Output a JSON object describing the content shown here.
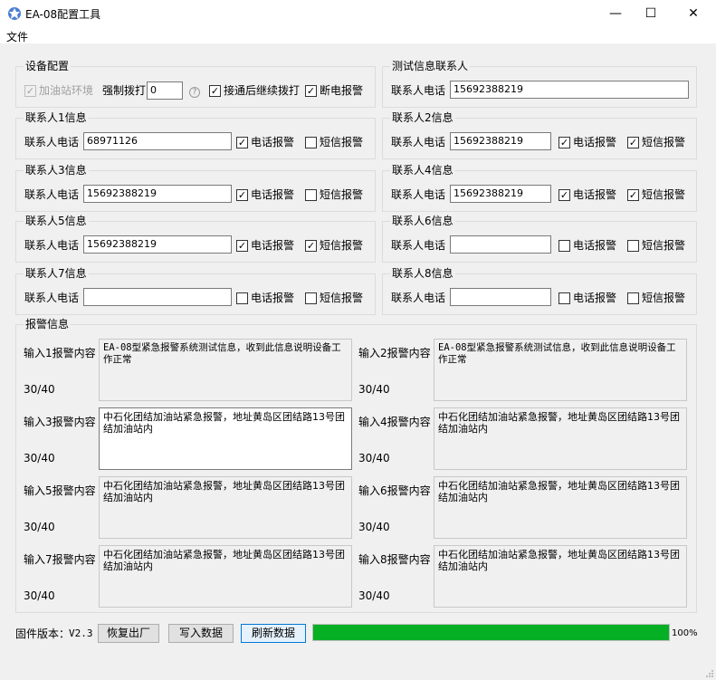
{
  "window": {
    "title": "EA-08配置工具",
    "minimize": "—",
    "maximize": "☐",
    "close": "✕"
  },
  "menu": {
    "file": "文件"
  },
  "device": {
    "group_title": "设备配置",
    "gas_station_env": "加油站环境",
    "gas_station_env_checked": true,
    "force_dial_label": "强制拨打",
    "force_dial_value": "0",
    "help": "?",
    "continue_after_connect": "接通后继续拨打",
    "continue_after_connect_checked": true,
    "power_off_alarm": "断电报警",
    "power_off_alarm_checked": true
  },
  "test_contact": {
    "group_title": "测试信息联系人",
    "phone_label": "联系人电话",
    "phone": "15692388219"
  },
  "contacts": [
    {
      "title": "联系人1信息",
      "phone_label": "联系人电话",
      "phone": "68971126",
      "call_label": "电话报警",
      "call": true,
      "sms_label": "短信报警",
      "sms": false
    },
    {
      "title": "联系人2信息",
      "phone_label": "联系人电话",
      "phone": "15692388219",
      "call_label": "电话报警",
      "call": true,
      "sms_label": "短信报警",
      "sms": true
    },
    {
      "title": "联系人3信息",
      "phone_label": "联系人电话",
      "phone": "15692388219",
      "call_label": "电话报警",
      "call": true,
      "sms_label": "短信报警",
      "sms": false
    },
    {
      "title": "联系人4信息",
      "phone_label": "联系人电话",
      "phone": "15692388219",
      "call_label": "电话报警",
      "call": true,
      "sms_label": "短信报警",
      "sms": true
    },
    {
      "title": "联系人5信息",
      "phone_label": "联系人电话",
      "phone": "15692388219",
      "call_label": "电话报警",
      "call": true,
      "sms_label": "短信报警",
      "sms": true
    },
    {
      "title": "联系人6信息",
      "phone_label": "联系人电话",
      "phone": "",
      "call_label": "电话报警",
      "call": false,
      "sms_label": "短信报警",
      "sms": false
    },
    {
      "title": "联系人7信息",
      "phone_label": "联系人电话",
      "phone": "",
      "call_label": "电话报警",
      "call": false,
      "sms_label": "短信报警",
      "sms": false
    },
    {
      "title": "联系人8信息",
      "phone_label": "联系人电话",
      "phone": "",
      "call_label": "电话报警",
      "call": false,
      "sms_label": "短信报警",
      "sms": false
    }
  ],
  "alarm": {
    "group_title": "报警信息",
    "inputs": [
      {
        "label": "输入1报警内容",
        "content": "EA-08型紧急报警系统测试信息，收到此信息说明设备工作正常",
        "count": "30/40"
      },
      {
        "label": "输入2报警内容",
        "content": "EA-08型紧急报警系统测试信息，收到此信息说明设备工作正常",
        "count": "30/40"
      },
      {
        "label": "输入3报警内容",
        "content": "中石化团结加油站紧急报警，地址黄岛区团结路13号团结加油站内",
        "count": "30/40"
      },
      {
        "label": "输入4报警内容",
        "content": "中石化团结加油站紧急报警，地址黄岛区团结路13号团结加油站内",
        "count": "30/40"
      },
      {
        "label": "输入5报警内容",
        "content": "中石化团结加油站紧急报警，地址黄岛区团结路13号团结加油站内",
        "count": "30/40"
      },
      {
        "label": "输入6报警内容",
        "content": "中石化团结加油站紧急报警，地址黄岛区团结路13号团结加油站内",
        "count": "30/40"
      },
      {
        "label": "输入7报警内容",
        "content": "中石化团结加油站紧急报警，地址黄岛区团结路13号团结加油站内",
        "count": "30/40"
      },
      {
        "label": "输入8报警内容",
        "content": "中石化团结加油站紧急报警，地址黄岛区团结路13号团结加油站内",
        "count": "30/40"
      }
    ]
  },
  "footer": {
    "firmware_label": "固件版本：",
    "firmware_version": "V2.3",
    "restore_button": "恢复出厂",
    "write_button": "写入数据",
    "refresh_button": "刷新数据",
    "progress": 1.0,
    "progress_text": "100%",
    "progress_color": "#06b025"
  }
}
